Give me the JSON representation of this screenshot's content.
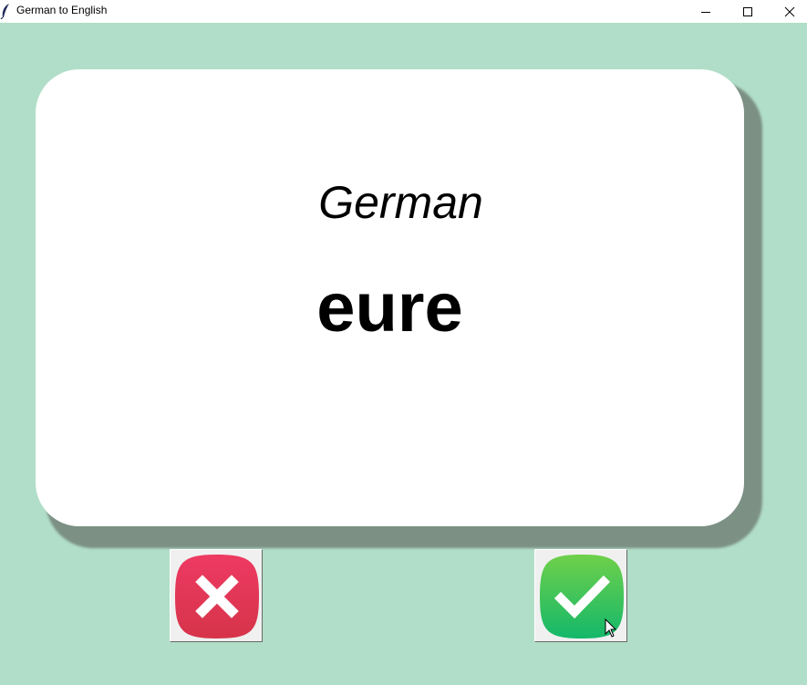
{
  "window": {
    "title": "German to English",
    "icon": "feather-icon",
    "controls": [
      "minimize-icon",
      "maximize-icon",
      "close-icon"
    ]
  },
  "card": {
    "language": "German",
    "word": "eure"
  },
  "buttons": {
    "wrong": {
      "icon": "cross-icon",
      "color": "#e43a5a"
    },
    "right": {
      "icon": "checkmark-icon",
      "color": "#3ec35c"
    }
  },
  "colors": {
    "background": "#b1dec8",
    "card": "#ffffff"
  }
}
